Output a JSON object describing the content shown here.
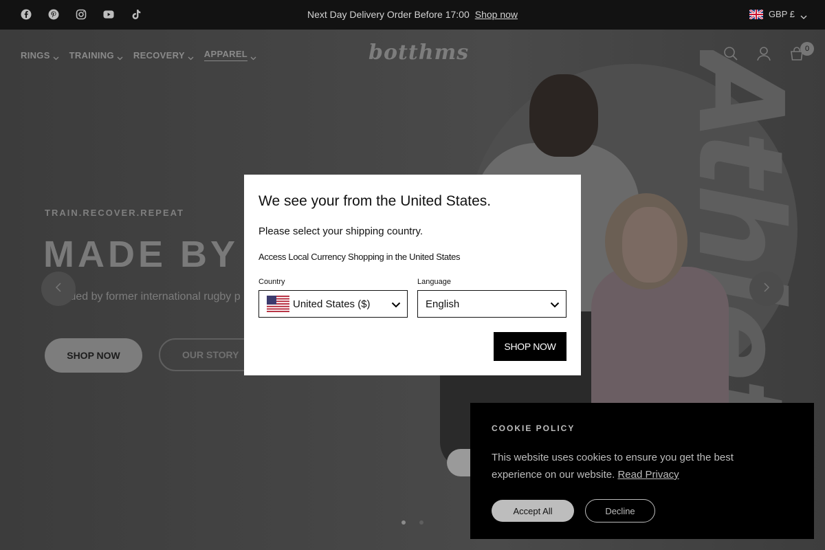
{
  "topbar": {
    "socials": [
      "facebook-icon",
      "pinterest-icon",
      "instagram-icon",
      "youtube-icon",
      "tiktok-icon"
    ],
    "announcement_text": "Next Day Delivery Order Before 17:00",
    "announcement_link": "Shop now",
    "currency": "GBP £"
  },
  "header": {
    "nav": [
      {
        "label": "RINGS"
      },
      {
        "label": "TRAINING"
      },
      {
        "label": "RECOVERY"
      },
      {
        "label": "APPAREL"
      }
    ],
    "logo": "botthms",
    "cart_count": "0"
  },
  "hero": {
    "eyebrow": "TRAIN.RECOVER.REPEAT",
    "title": "MADE BY A",
    "subtitle": "Founded by former international rugby p",
    "shop_now": "SHOP NOW",
    "our_story": "OUR STORY",
    "bg_word": "Athletes"
  },
  "modal": {
    "title": "We see your from the United States.",
    "subtitle": "Please select your shipping country.",
    "access_text": "Access Local Currency Shopping in the United States",
    "country_label": "Country",
    "country_value": "United States ($)",
    "language_label": "Language",
    "language_value": "English",
    "shop_button": "SHOP NOW"
  },
  "cookie": {
    "title": "COOKIE POLICY",
    "text": "This website uses cookies to ensure you get the best experience on our website.",
    "link": "Read Privacy",
    "accept": "Accept All",
    "decline": "Decline"
  },
  "colors": {
    "topbar_bg": "#121212",
    "overlay_gray": "#3a3a3a",
    "modal_bg": "#ffffff",
    "cookie_bg": "#000000"
  }
}
